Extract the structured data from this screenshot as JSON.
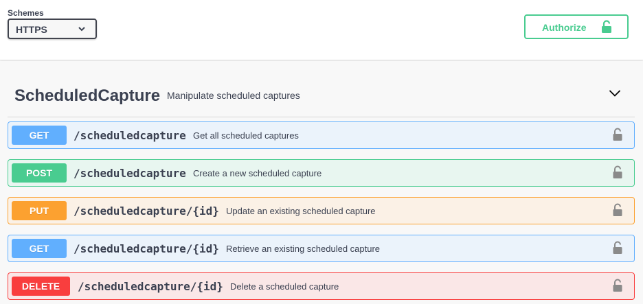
{
  "topbar": {
    "schemes_label": "Schemes",
    "schemes_value": "HTTPS",
    "authorize_label": "Authorize"
  },
  "tag": {
    "name": "ScheduledCapture",
    "description": "Manipulate scheduled captures"
  },
  "operations": [
    {
      "method": "GET",
      "path": "/scheduledcapture",
      "summary": "Get all scheduled captures",
      "color": "#61affe"
    },
    {
      "method": "POST",
      "path": "/scheduledcapture",
      "summary": "Create a new scheduled capture",
      "color": "#49cc90"
    },
    {
      "method": "PUT",
      "path": "/scheduledcapture/{id}",
      "summary": "Update an existing scheduled capture",
      "color": "#fca130"
    },
    {
      "method": "GET",
      "path": "/scheduledcapture/{id}",
      "summary": "Retrieve an existing scheduled capture",
      "color": "#61affe"
    },
    {
      "method": "DELETE",
      "path": "/scheduledcapture/{id}",
      "summary": "Delete a scheduled capture",
      "color": "#f93e3e"
    }
  ],
  "icons": {
    "schemes_dropdown": "chevron-down-icon",
    "authorize": "unlock-icon",
    "tag_toggle": "chevron-down-icon",
    "operation_lock": "unlock-icon"
  },
  "colors": {
    "accent_green": "#49cc90",
    "get": "#61affe",
    "post": "#49cc90",
    "put": "#fca130",
    "delete": "#f93e3e",
    "text": "#3b4151"
  }
}
